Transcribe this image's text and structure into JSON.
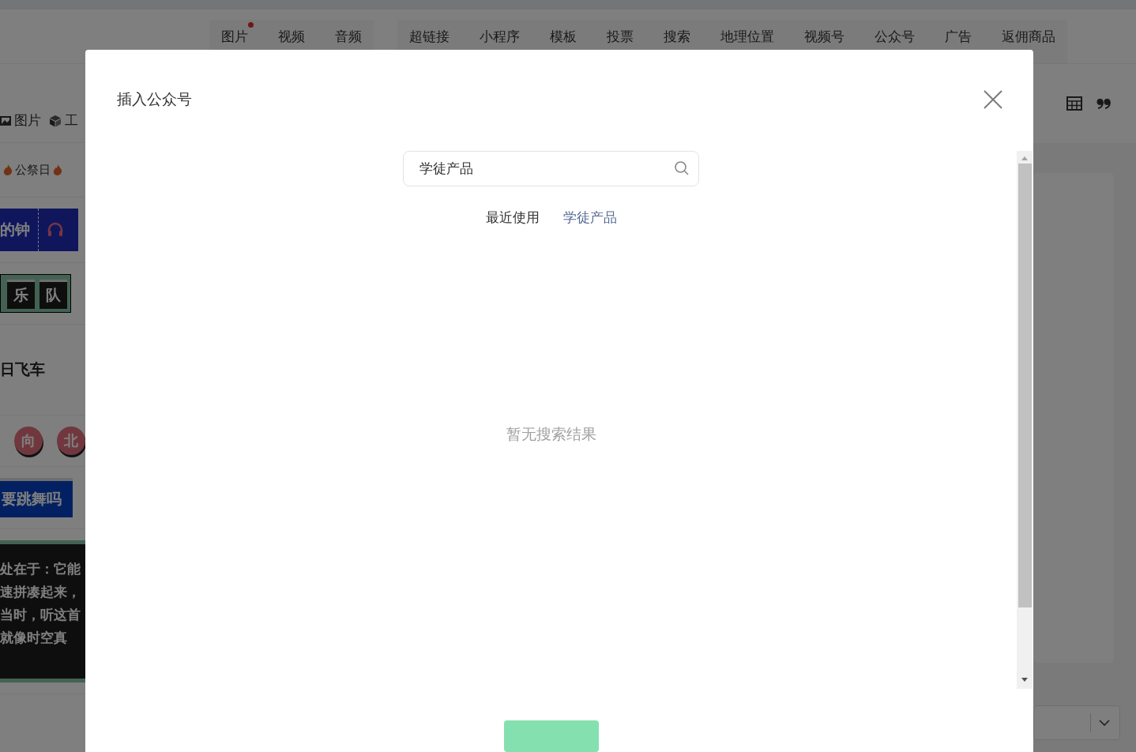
{
  "editor_toolbar": {
    "groups": [
      {
        "tabs": [
          {
            "label": "图片",
            "badge": true
          },
          {
            "label": "视频",
            "badge": false
          },
          {
            "label": "音频",
            "badge": false
          }
        ]
      },
      {
        "tabs": [
          {
            "label": "超链接",
            "badge": false
          },
          {
            "label": "小程序",
            "badge": false
          },
          {
            "label": "模板",
            "badge": false
          },
          {
            "label": "投票",
            "badge": false
          },
          {
            "label": "搜索",
            "badge": false
          },
          {
            "label": "地理位置",
            "badge": false
          },
          {
            "label": "视频号",
            "badge": false
          },
          {
            "label": "公众号",
            "badge": false
          },
          {
            "label": "广告",
            "badge": false
          },
          {
            "label": "返佣商品",
            "badge": false
          }
        ]
      }
    ]
  },
  "left_panel": {
    "tools": [
      {
        "kind": "image",
        "label": "图片"
      },
      {
        "kind": "cube",
        "label": "工"
      }
    ],
    "topic": "公祭日",
    "templates": [
      {
        "kind": "clock",
        "text": "的钟"
      },
      {
        "kind": "tiles",
        "tiles": [
          "乐",
          "队"
        ]
      },
      {
        "kind": "title",
        "text": "日飞车"
      },
      {
        "kind": "circles",
        "tiles": [
          "向",
          "北"
        ]
      },
      {
        "kind": "banner",
        "text": "要跳舞吗"
      },
      {
        "kind": "paragraph",
        "lines": [
          "处在于：它能",
          "速拼凑起来，",
          "当时，听这首",
          "就像时空真"
        ]
      }
    ]
  },
  "dialog": {
    "title": "插入公众号",
    "search": {
      "value": "学徒产品"
    },
    "tabs": [
      {
        "label": "最近使用",
        "selected": false
      },
      {
        "label": "学徒产品",
        "selected": true
      }
    ],
    "empty_message": "暂无搜索结果"
  }
}
